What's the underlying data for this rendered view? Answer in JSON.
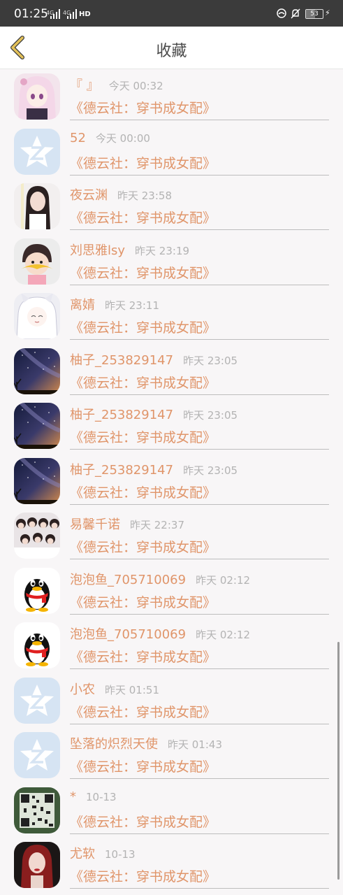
{
  "status_bar": {
    "time": "01:25",
    "signal1_label": "4G",
    "signal2_label": "4G",
    "hd_label": "HD",
    "battery_level": "53",
    "battery_fill_fraction": 0.53
  },
  "header": {
    "title": "收藏",
    "back_icon": "chevron-left-icon"
  },
  "items": [
    {
      "name": "『 』",
      "time": "今天 00:32",
      "book": "《德云社：穿书成女配》",
      "avatar": "anime-girl-pink"
    },
    {
      "name": "52",
      "time": "今天 00:00",
      "book": "《德云社：穿书成女配》",
      "avatar": "qzone-default"
    },
    {
      "name": "夜云渊",
      "time": "昨天 23:58",
      "book": "《德云社：穿书成女配》",
      "avatar": "girl-photo"
    },
    {
      "name": "刘思雅lsy",
      "time": "昨天 23:19",
      "book": "《德云社：穿书成女配》",
      "avatar": "cartoon-character"
    },
    {
      "name": "离婧",
      "time": "昨天 23:11",
      "book": "《德云社：穿书成女配》",
      "avatar": "anime-girl-white"
    },
    {
      "name": "柚子_253829147",
      "time": "昨天 23:05",
      "book": "《德云社：穿书成女配》",
      "avatar": "night-sky"
    },
    {
      "name": "柚子_253829147",
      "time": "昨天 23:05",
      "book": "《德云社：穿书成女配》",
      "avatar": "night-sky"
    },
    {
      "name": "柚子_253829147",
      "time": "昨天 23:05",
      "book": "《德云社：穿书成女配》",
      "avatar": "night-sky"
    },
    {
      "name": "易馨千诺",
      "time": "昨天 22:37",
      "book": "《德云社：穿书成女配》",
      "avatar": "group-photo"
    },
    {
      "name": "泡泡鱼_705710069",
      "time": "昨天 02:12",
      "book": "《德云社：穿书成女配》",
      "avatar": "qq-penguin"
    },
    {
      "name": "泡泡鱼_705710069",
      "time": "昨天 02:12",
      "book": "《德云社：穿书成女配》",
      "avatar": "qq-penguin"
    },
    {
      "name": "小农",
      "time": "昨天 01:51",
      "book": "《德云社：穿书成女配》",
      "avatar": "qzone-default"
    },
    {
      "name": "坠落的炽烈天使",
      "time": "昨天 01:43",
      "book": "《德云社：穿书成女配》",
      "avatar": "qzone-default"
    },
    {
      "name": "*",
      "time": "10-13",
      "book": "《德云社：穿书成女配》",
      "avatar": "qr-code"
    },
    {
      "name": "尤软",
      "time": "10-13",
      "book": "《德云社：穿书成女配》",
      "avatar": "redhead-girl"
    }
  ],
  "colors": {
    "accent": "#e0956a",
    "time_gray": "#b3b3b3",
    "back_icon": "#c9a63a",
    "status_bar": "#3b3b3b"
  }
}
